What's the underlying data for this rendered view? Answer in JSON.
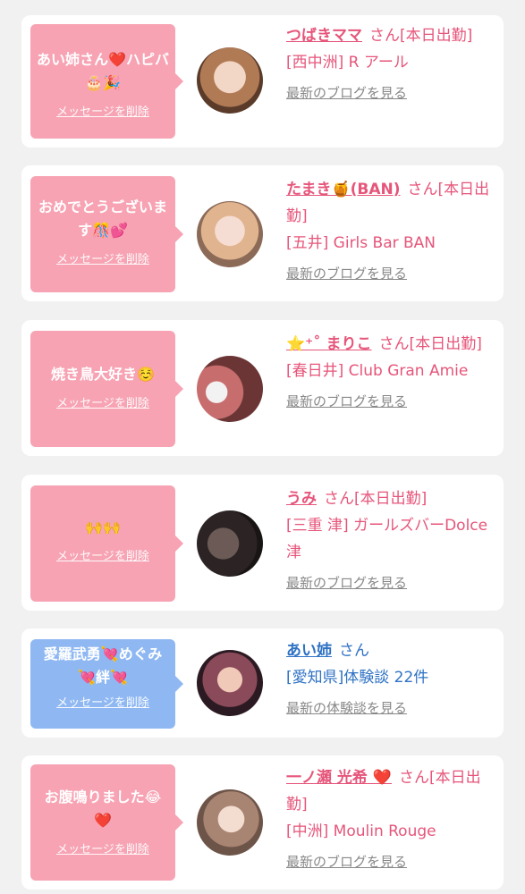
{
  "delete_label": "メッセージを削除",
  "cards": [
    {
      "message": "あい姉さん❤️ハピバ🎂🎉",
      "name": "つばきママ",
      "suffix": "さん[本日出勤]",
      "shop": "[西中洲] R アール",
      "link": "最新のブログを見る"
    },
    {
      "message": "おめでとうございます🎊💕",
      "name": "たまき🍯(BAN)",
      "suffix": "さん[本日出勤]",
      "shop": "[五井] Girls Bar BAN",
      "link": "最新のブログを見る"
    },
    {
      "message": "焼き鳥大好き☺️",
      "name": "⭐️⁺˚ まりこ",
      "suffix": "さん[本日出勤]",
      "shop": "[春日井] Club Gran Amie",
      "link": "最新のブログを見る"
    },
    {
      "message": "🙌🙌",
      "name": "うみ",
      "suffix": "さん[本日出勤]",
      "shop": "[三重 津] ガールズバーDolce津",
      "link": "最新のブログを見る"
    },
    {
      "message": "愛羅武勇💘めぐみ💘絆💘",
      "name": "あい姉",
      "suffix": "さん",
      "shop": "[愛知県]体験談 22件",
      "link": "最新の体験談を見る"
    },
    {
      "message": "お腹鳴りました😂❤️",
      "name": "一ノ瀬 光希 ❤️",
      "suffix": "さん[本日出勤]",
      "shop": "[中洲] Moulin Rouge",
      "link": "最新のブログを見る"
    }
  ]
}
